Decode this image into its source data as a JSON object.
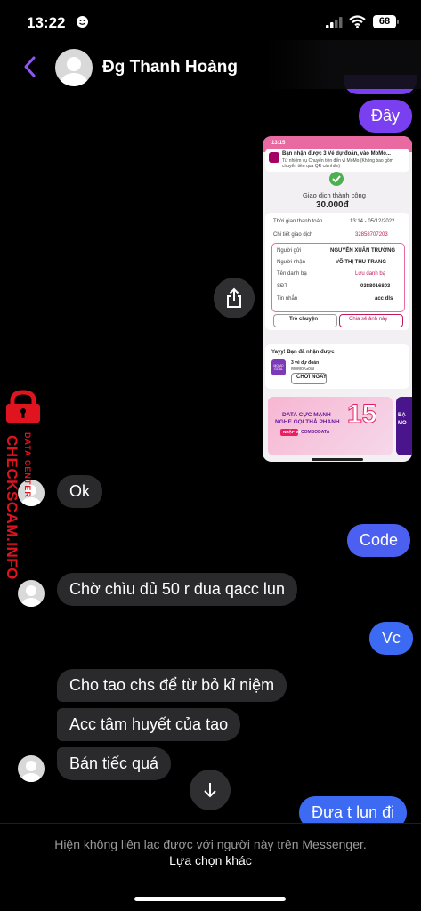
{
  "status_bar": {
    "time": "13:22",
    "battery": "68"
  },
  "header": {
    "contact_name": "Đg Thanh Hoàng"
  },
  "colors": {
    "accent": "#7b3ff2",
    "bubble_out_top": "#7b3ff2",
    "bubble_out_bottom": "#3d6af2",
    "bubble_in": "#2a2a2c"
  },
  "messages": {
    "day": "Đây",
    "ok": "Ok",
    "code": "Code",
    "cho": "Chờ chìu đủ 50 r đua qacc lun",
    "vc": "Vc",
    "cho_tao": "Cho tao chs để từ bỏ kỉ niệm",
    "acc": "Acc tâm huyết của tao",
    "ban": "Bán tiếc quá",
    "dua": "Đưa t lun đi"
  },
  "receipt": {
    "time": "13:15",
    "notif_title": "Bạn nhận được 3 Vé dự đoán, vào MoMo...",
    "notif_body": "Từ nhiệm vụ Chuyển tiền đến ví MoMo (Không bao gồm chuyển tiền qua QR cá nhân)",
    "success": "Giao dịch thành công",
    "amount": "30.000đ",
    "time_label": "Thời gian thanh toán",
    "time_value": "13:14 - 05/12/2022",
    "detail_label": "Chi tiết giao dịch",
    "detail_value": "32858707203",
    "sender_label": "Người gửi",
    "sender_value": "NGUYỄN XUÂN TRƯỜNG",
    "receiver_label": "Người nhận",
    "receiver_value": "VÕ THỊ THU TRANG",
    "contact_label": "Tên danh bạ",
    "contact_value": "Lưu danh bạ",
    "phone_label": "SĐT",
    "phone_value": "0388016803",
    "msg_label": "Tin nhắn",
    "msg_value": "acc dls",
    "btn_chat": "Trò chuyện",
    "btn_share": "Chia sẻ ảnh này",
    "promo_title": "Yayy! Bạn đã nhận được",
    "promo_logo": "MOMO GOAL",
    "promo_ticket": "3 vé dự đoán",
    "promo_sub": "MoMo Goal",
    "promo_btn": "CHƠI NGAY",
    "banner_line1": "DATA CỰC MẠNH",
    "banner_line2": "NGHE GỌI THẢ PHANH",
    "banner_cta": "NHẬP MÃ",
    "banner_code": "COMBODATA",
    "banner_15": "15",
    "side_text": "BẠ MO"
  },
  "watermark": {
    "title": "CHECKSCAM.INFO",
    "sub": "DATA CENTER"
  },
  "footer": {
    "notice": "Hiện không liên lạc được với người này trên Messenger.",
    "action": "Lựa chọn khác"
  }
}
